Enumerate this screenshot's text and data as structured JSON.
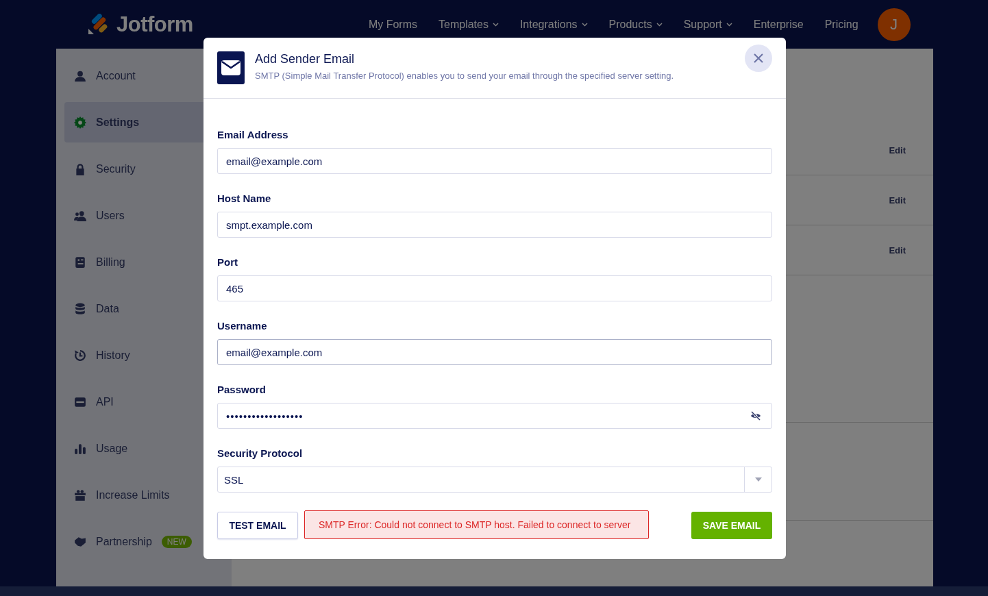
{
  "header": {
    "logo": "Jotform",
    "nav": [
      {
        "label": "My Forms",
        "caret": false
      },
      {
        "label": "Templates",
        "caret": true
      },
      {
        "label": "Integrations",
        "caret": true
      },
      {
        "label": "Products",
        "caret": true
      },
      {
        "label": "Support",
        "caret": true
      },
      {
        "label": "Enterprise",
        "caret": false
      },
      {
        "label": "Pricing",
        "caret": false
      }
    ],
    "avatar": "J"
  },
  "sidebar": {
    "items": [
      {
        "label": "Account",
        "selected": false
      },
      {
        "label": "Settings",
        "selected": true
      },
      {
        "label": "Security",
        "selected": false
      },
      {
        "label": "Users",
        "selected": false
      },
      {
        "label": "Billing",
        "selected": false
      },
      {
        "label": "Data",
        "selected": false
      },
      {
        "label": "History",
        "selected": false
      },
      {
        "label": "API",
        "selected": false
      },
      {
        "label": "Usage",
        "selected": false
      },
      {
        "label": "Increase Limits",
        "selected": false
      },
      {
        "label": "Partnership",
        "selected": false,
        "badge": "NEW"
      }
    ]
  },
  "main": {
    "rows": [
      {
        "action": "Edit"
      },
      {
        "action": "Edit"
      },
      {
        "action": "Edit"
      },
      {},
      {},
      {}
    ]
  },
  "dialog": {
    "title": "Add Sender Email",
    "subtitle": "SMTP (Simple Mail Transfer Protocol) enables you to send your email through the specified server setting.",
    "fields": [
      {
        "label": "Email Address",
        "kind": "text",
        "value": "email@example.com",
        "focused": false
      },
      {
        "label": "Host Name",
        "kind": "text",
        "value": "smpt.example.com",
        "focused": false
      },
      {
        "label": "Port",
        "kind": "text",
        "value": "465",
        "focused": false
      },
      {
        "label": "Username",
        "kind": "text",
        "value": "email@example.com",
        "focused": true
      },
      {
        "label": "Password",
        "kind": "password",
        "value": "••••••••••••••••••",
        "focused": false
      },
      {
        "label": "Security Protocol",
        "kind": "select",
        "value": "SSL",
        "focused": false
      }
    ],
    "test_button": "TEST EMAIL",
    "error": "SMTP Error: Could not connect to SMTP host. Failed to connect to server",
    "save_button": "SAVE EMAIL"
  }
}
